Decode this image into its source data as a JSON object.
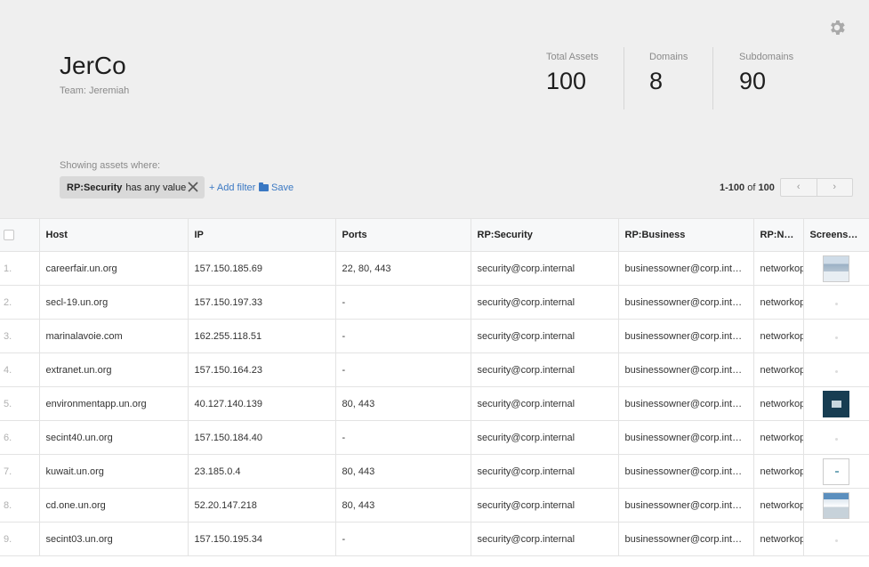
{
  "org": {
    "name": "JerCo",
    "team": "Team: Jeremiah"
  },
  "stats": [
    {
      "label": "Total Assets",
      "value": "100"
    },
    {
      "label": "Domains",
      "value": "8"
    },
    {
      "label": "Subdomains",
      "value": "90"
    }
  ],
  "filters": {
    "showing_label": "Showing assets where:",
    "chip_key": "RP:Security",
    "chip_condition": "has any value",
    "add_filter": "+ Add filter",
    "save": "Save"
  },
  "pagination": {
    "range": "1-100",
    "of": "of",
    "total": "100",
    "prev": "‹",
    "next": "›"
  },
  "table": {
    "columns": [
      "Host",
      "IP",
      "Ports",
      "RP:Security",
      "RP:Business",
      "RP:Network",
      "Screenshot"
    ],
    "rows": [
      {
        "num": "1.",
        "host": "careerfair.un.org",
        "ip": "157.150.185.69",
        "ports": "22, 80, 443",
        "security": "security@corp.internal",
        "business": "businessowner@corp.internal",
        "network": "networkops",
        "screenshot": "site"
      },
      {
        "num": "2.",
        "host": "secl-19.un.org",
        "ip": "157.150.197.33",
        "ports": "-",
        "security": "security@corp.internal",
        "business": "businessowner@corp.internal",
        "network": "networkops",
        "screenshot": "none"
      },
      {
        "num": "3.",
        "host": "marinalavoie.com",
        "ip": "162.255.118.51",
        "ports": "-",
        "security": "security@corp.internal",
        "business": "businessowner@corp.internal",
        "network": "networkops",
        "screenshot": "none"
      },
      {
        "num": "4.",
        "host": "extranet.un.org",
        "ip": "157.150.164.23",
        "ports": "-",
        "security": "security@corp.internal",
        "business": "businessowner@corp.internal",
        "network": "networkops",
        "screenshot": "none"
      },
      {
        "num": "5.",
        "host": "environmentapp.un.org",
        "ip": "40.127.140.139",
        "ports": "80, 443",
        "security": "security@corp.internal",
        "business": "businessowner@corp.internal",
        "network": "networkops",
        "screenshot": "dark"
      },
      {
        "num": "6.",
        "host": "secint40.un.org",
        "ip": "157.150.184.40",
        "ports": "-",
        "security": "security@corp.internal",
        "business": "businessowner@corp.internal",
        "network": "networkops",
        "screenshot": "none"
      },
      {
        "num": "7.",
        "host": "kuwait.un.org",
        "ip": "23.185.0.4",
        "ports": "80, 443",
        "security": "security@corp.internal",
        "business": "businessowner@corp.internal",
        "network": "networkops",
        "screenshot": "white"
      },
      {
        "num": "8.",
        "host": "cd.one.un.org",
        "ip": "52.20.147.218",
        "ports": "80, 443",
        "security": "security@corp.internal",
        "business": "businessowner@corp.internal",
        "network": "networkops",
        "screenshot": "web"
      },
      {
        "num": "9.",
        "host": "secint03.un.org",
        "ip": "157.150.195.34",
        "ports": "-",
        "security": "security@corp.internal",
        "business": "businessowner@corp.internal",
        "network": "networkops",
        "screenshot": "none"
      }
    ]
  },
  "icons": {
    "settings": "gear-icon",
    "remove_filter": "close-icon",
    "save": "folder-icon"
  },
  "colors": {
    "link": "#3a78c3",
    "header_bg": "#efefef"
  }
}
